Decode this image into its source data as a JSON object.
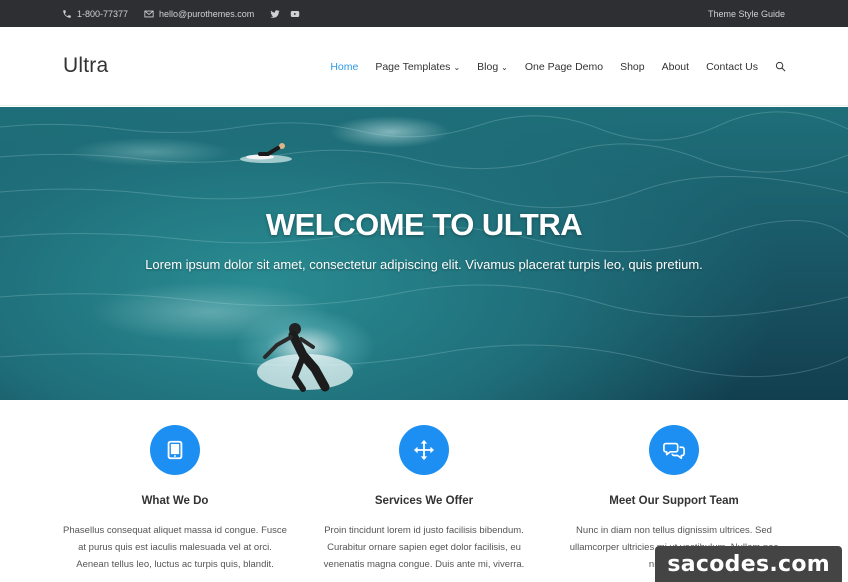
{
  "topbar": {
    "phone_icon": "phone-icon",
    "phone": "1-800-77377",
    "email_icon": "envelope-icon",
    "email": "hello@purothemes.com",
    "social": [
      "twitter-icon",
      "youtube-icon"
    ],
    "right_link": "Theme Style Guide"
  },
  "header": {
    "logo": "Ultra",
    "nav": [
      {
        "label": "Home",
        "active": true,
        "dropdown": false
      },
      {
        "label": "Page Templates",
        "active": false,
        "dropdown": true
      },
      {
        "label": "Blog",
        "active": false,
        "dropdown": true
      },
      {
        "label": "One Page Demo",
        "active": false,
        "dropdown": false
      },
      {
        "label": "Shop",
        "active": false,
        "dropdown": false
      },
      {
        "label": "About",
        "active": false,
        "dropdown": false
      },
      {
        "label": "Contact Us",
        "active": false,
        "dropdown": false
      }
    ],
    "search_icon": "search-icon",
    "caret": "⌄"
  },
  "hero": {
    "title": "WELCOME TO ULTRA",
    "subtitle": "Lorem ipsum dolor sit amet, consectetur adipiscing elit. Vivamus placerat turpis leo, quis pretium."
  },
  "features": [
    {
      "icon": "tablet-icon",
      "title": "What We Do",
      "lines": [
        "Phasellus consequat aliquet massa id congue. Fusce",
        "at purus quis est iaculis malesuada vel at orci.",
        "Aenean tellus leo, luctus ac turpis quis, blandit."
      ]
    },
    {
      "icon": "move-arrows-icon",
      "title": "Services We Offer",
      "lines": [
        "Proin tincidunt lorem id justo facilisis bibendum.",
        "Curabitur ornare sapien eget dolor facilisis, eu",
        "venenatis magna congue. Duis ante mi, viverra."
      ]
    },
    {
      "icon": "chat-bubbles-icon",
      "title": "Meet Our Support Team",
      "lines": [
        "Nunc in diam non tellus dignissim ultrices. Sed",
        "ullamcorper ultricies mi ut vestibulum. Nullam nec",
        "nisi sit amet"
      ]
    }
  ],
  "watermark": "sacodes.com",
  "colors": {
    "accent": "#1d8ff2",
    "nav_active": "#2f98e6",
    "topbar_bg": "#2d2f33"
  }
}
